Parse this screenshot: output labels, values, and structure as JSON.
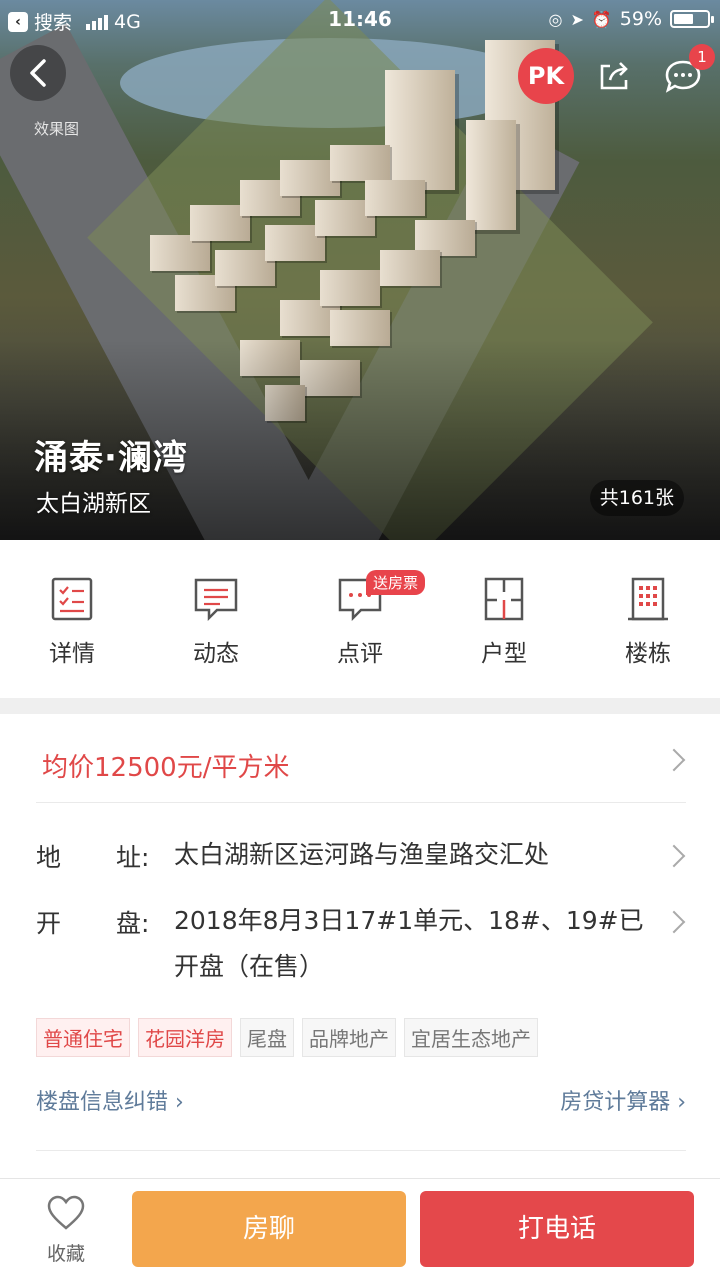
{
  "status_bar": {
    "back_app": "搜索",
    "network": "4G",
    "time": "11:46",
    "battery": "59%",
    "battery_level": 0.59
  },
  "hero": {
    "pk_label": "PK",
    "message_badge": "1",
    "effect_label": "效果图",
    "title": "涌泰·澜湾",
    "area": "太白湖新区",
    "photo_count": "共161张"
  },
  "nav": {
    "items": [
      {
        "label": "详情",
        "icon": "details-icon"
      },
      {
        "label": "动态",
        "icon": "news-icon"
      },
      {
        "label": "点评",
        "icon": "comment-icon"
      },
      {
        "label": "户型",
        "icon": "floorplan-icon"
      },
      {
        "label": "楼栋",
        "icon": "building-icon"
      }
    ],
    "comment_badge": "送房票"
  },
  "info": {
    "price": "均价12500元/平方米",
    "address_key_1": "地",
    "address_key_2": "址:",
    "address_value": "太白湖新区运河路与渔皇路交汇处",
    "open_key_1": "开",
    "open_key_2": "盘:",
    "open_value": "2018年8月3日17#1单元、18#、19#已开盘（在售）",
    "tags": [
      "普通住宅",
      "花园洋房",
      "尾盘",
      "品牌地产",
      "宜居生态地产"
    ],
    "correction_link": "楼盘信息纠错",
    "calculator_link": "房贷计算器"
  },
  "bottom_bar": {
    "favorite_label": "收藏",
    "chat_label": "房聊",
    "call_label": "打电话"
  },
  "colors": {
    "accent_red": "#e4484b",
    "accent_orange": "#f3a64d",
    "link_blue": "#5f7b9a"
  }
}
